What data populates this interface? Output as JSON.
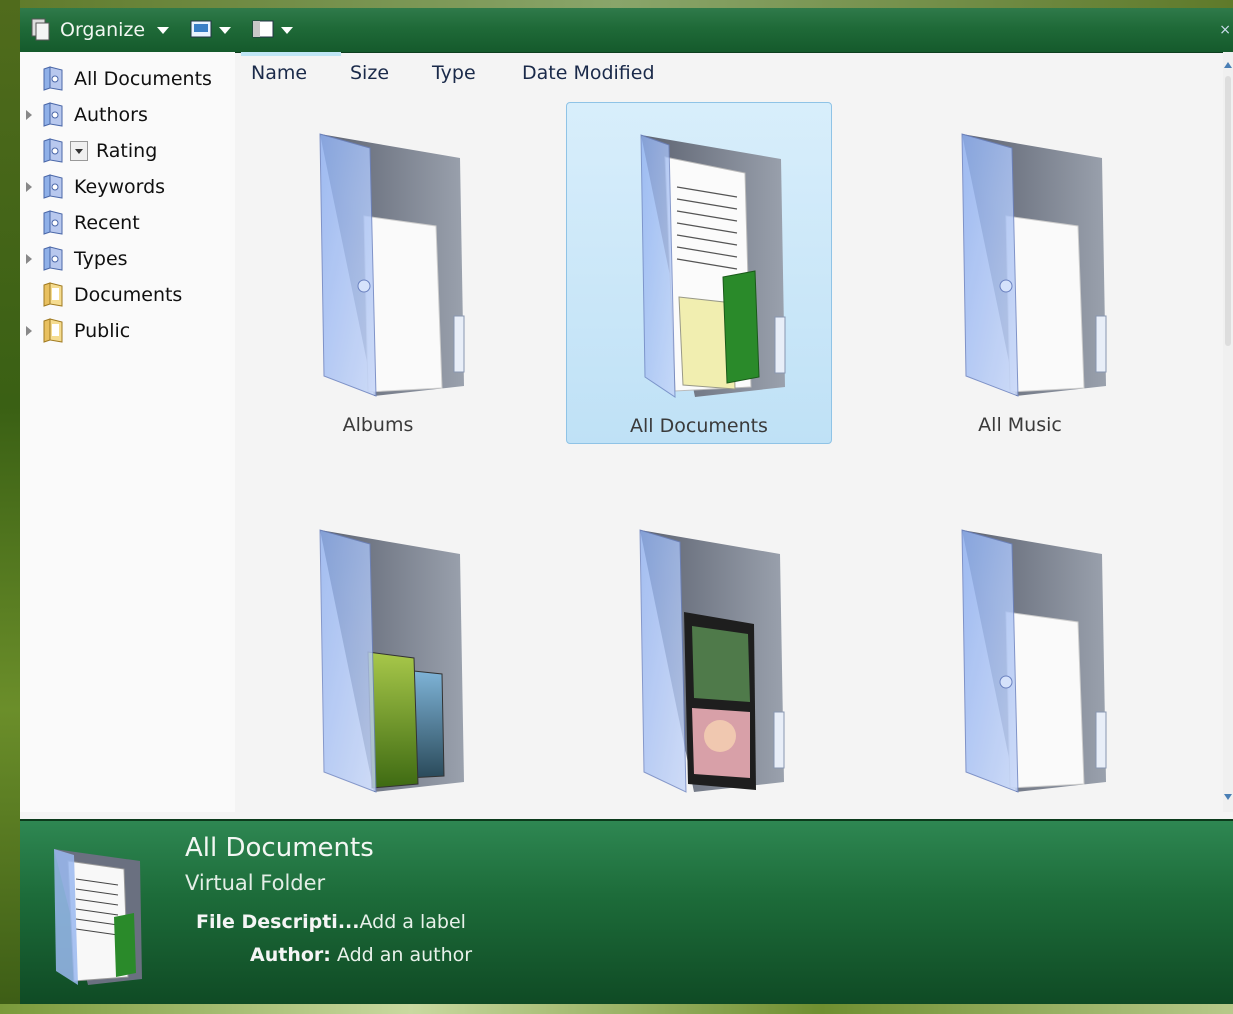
{
  "toolbar": {
    "organize_label": "Organize",
    "views_icon": "views-icon",
    "layout_icon": "layout-icon",
    "close_label": "×"
  },
  "nav": {
    "items": [
      {
        "label": "All Documents",
        "icon": "virtual-folder-icon",
        "has_arrow": false
      },
      {
        "label": "Authors",
        "icon": "virtual-folder-icon",
        "has_arrow": true
      },
      {
        "label": "Rating",
        "icon": "virtual-folder-icon",
        "has_arrow": false
      },
      {
        "label": "Keywords",
        "icon": "virtual-folder-icon",
        "has_arrow": true
      },
      {
        "label": "Recent",
        "icon": "virtual-folder-icon",
        "has_arrow": false
      },
      {
        "label": "Types",
        "icon": "virtual-folder-icon",
        "has_arrow": true
      },
      {
        "label": "Documents",
        "icon": "folder-icon",
        "has_arrow": false
      },
      {
        "label": "Public",
        "icon": "folder-icon",
        "has_arrow": true
      }
    ]
  },
  "columns": {
    "name": "Name",
    "size": "Size",
    "type": "Type",
    "date_modified": "Date Modified"
  },
  "tiles": [
    {
      "label": "Albums",
      "selected": false,
      "content": "blank-paper"
    },
    {
      "label": "All Documents",
      "selected": true,
      "content": "documents"
    },
    {
      "label": "All Music",
      "selected": false,
      "content": "blank-paper"
    },
    {
      "label": "",
      "selected": false,
      "content": "photos"
    },
    {
      "label": "",
      "selected": false,
      "content": "videos"
    },
    {
      "label": "",
      "selected": false,
      "content": "blank-paper"
    }
  ],
  "details": {
    "title": "All Documents",
    "type": "Virtual Folder",
    "file_description_key": "File Descripti...",
    "file_description_value": "Add a label",
    "author_key": "Author:",
    "author_value": "Add an author"
  },
  "colors": {
    "toolbar_green": "#1f6a38",
    "details_green": "#1d6c3a",
    "selection_blue": "#bfe1f6"
  }
}
